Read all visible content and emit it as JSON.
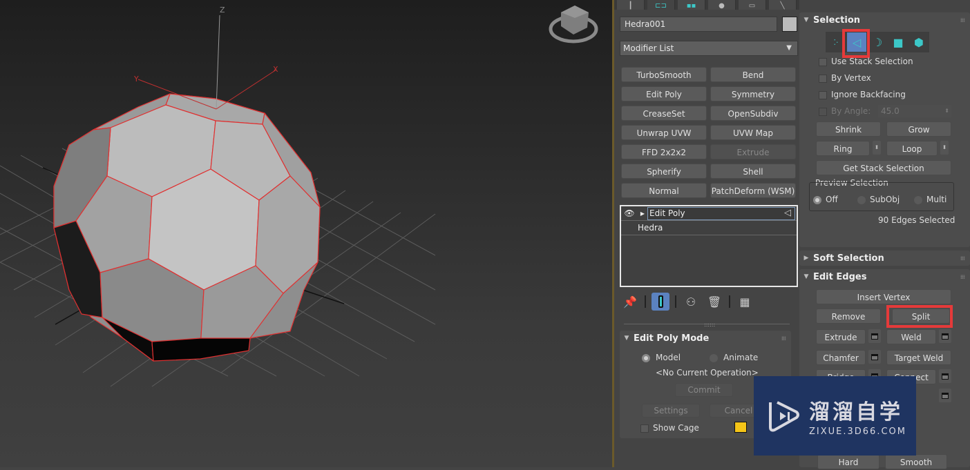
{
  "viewport": {
    "axis_labels": {
      "x": "X",
      "y": "Y",
      "z": "Z"
    },
    "edge_color": "#e03030"
  },
  "command_panel": {
    "tabs": [
      "create",
      "modify",
      "hierarchy",
      "motion",
      "display",
      "utilities"
    ],
    "object_name": "Hedra001",
    "object_color": "#bbbbbb",
    "modifier_list_label": "Modifier List",
    "modifier_buttons": [
      {
        "label": "TurboSmooth",
        "enabled": true
      },
      {
        "label": "Bend",
        "enabled": true
      },
      {
        "label": "Edit Poly",
        "enabled": true
      },
      {
        "label": "Symmetry",
        "enabled": true
      },
      {
        "label": "CreaseSet",
        "enabled": true
      },
      {
        "label": "OpenSubdiv",
        "enabled": true
      },
      {
        "label": "Unwrap UVW",
        "enabled": true
      },
      {
        "label": "UVW Map",
        "enabled": true
      },
      {
        "label": "FFD 2x2x2",
        "enabled": true
      },
      {
        "label": "Extrude",
        "enabled": false
      },
      {
        "label": "Spherify",
        "enabled": true
      },
      {
        "label": "Shell",
        "enabled": true
      },
      {
        "label": "Normal",
        "enabled": true
      },
      {
        "label": "PatchDeform (WSM)",
        "enabled": true
      }
    ],
    "stack": [
      {
        "label": "Edit Poly",
        "selected": true
      },
      {
        "label": "Hedra",
        "selected": false
      }
    ],
    "edit_poly_mode": {
      "title": "Edit Poly Mode",
      "model_label": "Model",
      "animate_label": "Animate",
      "selected_mode": "Model",
      "current_operation": "<No Current Operation>",
      "commit_label": "Commit",
      "settings_label": "Settings",
      "cancel_label": "Cancel",
      "show_cage_label": "Show Cage",
      "cage_color": "#f5c518"
    }
  },
  "selection": {
    "title": "Selection",
    "subobject_levels": [
      "vertex",
      "edge",
      "border",
      "polygon",
      "element"
    ],
    "active_level": "edge",
    "use_stack_selection": "Use Stack Selection",
    "by_vertex": "By Vertex",
    "ignore_backfacing": "Ignore Backfacing",
    "by_angle": "By Angle:",
    "by_angle_value": "45.0",
    "shrink": "Shrink",
    "grow": "Grow",
    "ring": "Ring",
    "loop": "Loop",
    "get_stack_selection": "Get Stack Selection",
    "preview_selection": {
      "title": "Preview Selection",
      "options": [
        "Off",
        "SubObj",
        "Multi"
      ],
      "selected": "Off"
    },
    "status": "90 Edges Selected"
  },
  "soft_selection": {
    "title": "Soft Selection"
  },
  "edit_edges": {
    "title": "Edit Edges",
    "insert_vertex": "Insert Vertex",
    "remove": "Remove",
    "split": "Split",
    "extrude": "Extrude",
    "weld": "Weld",
    "chamfer": "Chamfer",
    "target_weld": "Target Weld",
    "bridge": "Bridge",
    "connect": "Connect",
    "hard": "Hard",
    "smooth": "Smooth"
  },
  "watermark": {
    "name": "溜溜自学",
    "url": "ZIXUE.3D66.COM",
    "bg_color": "#1f3461"
  },
  "highlight_color": "#e53a3a"
}
